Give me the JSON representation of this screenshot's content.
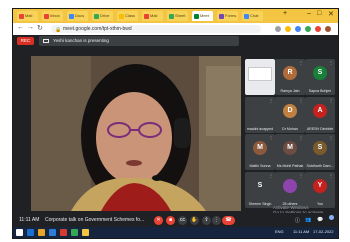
{
  "browser": {
    "tabs": [
      {
        "label": "Mail",
        "color": "#ea4335"
      },
      {
        "label": "Inbox",
        "color": "#ea4335"
      },
      {
        "label": "Docs",
        "color": "#4285f4"
      },
      {
        "label": "Drive",
        "color": "#34a853"
      },
      {
        "label": "Class",
        "color": "#fbbc05"
      },
      {
        "label": "Mail",
        "color": "#ea4335"
      },
      {
        "label": "Sheet",
        "color": "#34a853"
      },
      {
        "label": "Meet",
        "color": "#00832d",
        "active": true
      },
      {
        "label": "Forms",
        "color": "#7248b9"
      },
      {
        "label": "Chat",
        "color": "#4285f4"
      }
    ],
    "url": "meet.google.com/tpt-xthm-bwd",
    "new_tab": "+"
  },
  "meeting": {
    "rec_label": "REC",
    "presenting_banner": "Yeshi kanchan is presenting",
    "time": "11:11 AM",
    "title": "Corporate talk on Government Schemes fo...",
    "end_icon": "call-end-icon",
    "accent": "#ea4335"
  },
  "participants": [
    {
      "name": "Presentation",
      "initial": "",
      "color": "#e8eaed"
    },
    {
      "name": "Ramya Jain",
      "initial": "R",
      "color": "#b06b3a"
    },
    {
      "name": "Sapna Bohjee",
      "initial": "S",
      "color": "#188038"
    },
    {
      "name": "maalini acapped",
      "initial": "",
      "color": "#3c4043"
    },
    {
      "name": "Dr Mohan",
      "initial": "D",
      "color": "#c08040"
    },
    {
      "name": "ARESH Dimbble",
      "initial": "A",
      "color": "#c5221f"
    },
    {
      "name": "Maithi Sonna",
      "initial": "M",
      "color": "#8b5a3c"
    },
    {
      "name": "Ms Mohil Pathak",
      "initial": "M",
      "color": "#6d4c41"
    },
    {
      "name": "Siddharth Dam...",
      "initial": "S",
      "color": "#7b5a2e"
    },
    {
      "name": "Shreem Singh",
      "initial": "S",
      "color": "#3c4043"
    },
    {
      "name": "28 others",
      "initial": "",
      "color": "#8e44ad"
    },
    {
      "name": "You",
      "initial": "Y",
      "color": "#c5221f"
    }
  ],
  "watermark": {
    "line1": "Activate Windows",
    "line2": "Go to Settings to activate Windows."
  },
  "taskbar": {
    "time": "11:11 AM",
    "date": "17-02-2022",
    "lang": "ENG"
  }
}
